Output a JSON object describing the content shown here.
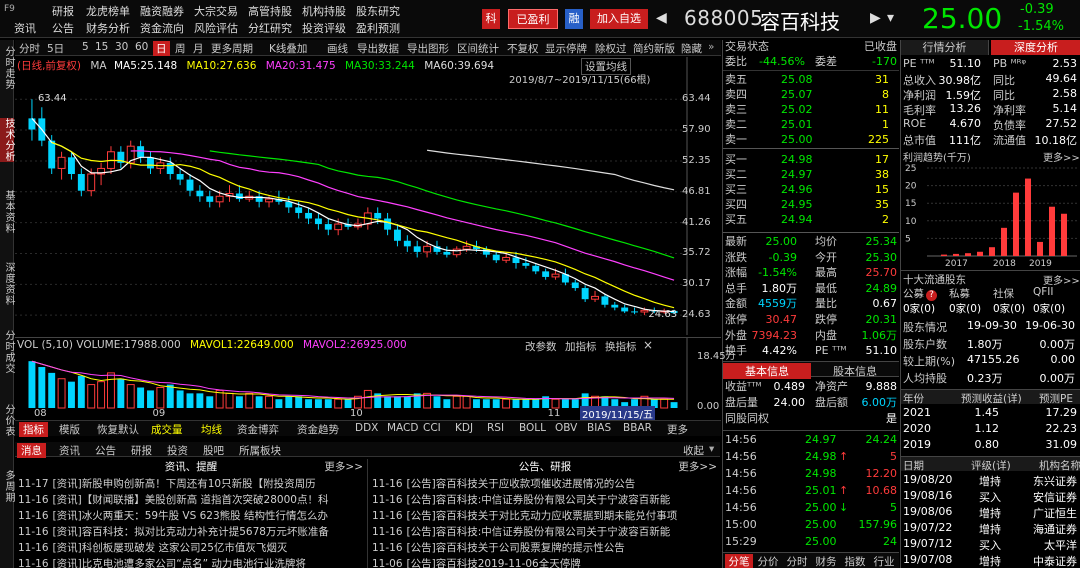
{
  "top": {
    "f9": "F9",
    "menu_row1": [
      "研报",
      "龙虎榜单",
      "融资融券",
      "大宗交易",
      "高管持股",
      "机构持股",
      "股东研究"
    ],
    "menu_row2": [
      "资讯",
      "公告",
      "财务分析",
      "资金流向",
      "风险评估",
      "分红研究",
      "投资评级",
      "盈利预测"
    ],
    "btn_rong": "融",
    "btn_yingli": "已盈利",
    "btn_ke": "科",
    "btn_add": "加入自选",
    "stock_code": "688005",
    "stock_name": "容百科技",
    "price": "25.00",
    "change": "-0.39",
    "change_pct": "-1.54%",
    "colors": {
      "up": "#ff3b3b",
      "down": "#00e600"
    }
  },
  "left_tabs": [
    "分时走势",
    "技术分析",
    "基本资料",
    "深度资料",
    "分时成交",
    "分价表",
    "多周期"
  ],
  "chart_toolbar": [
    "分时",
    "5日",
    "5",
    "15",
    "30",
    "60",
    "日",
    "周",
    "月",
    "更多周期",
    "K线叠加",
    "画线",
    "导出数据",
    "导出图形",
    "区间统计",
    "不复权",
    "显示停牌",
    "除权过",
    "简约新版",
    "隐藏"
  ],
  "chart_toolbar_active": "日",
  "ma_legend": {
    "prefix": "(日线,前复权)",
    "ma": "MA",
    "ma5": "MA5:25.148",
    "ma10": "MA10:27.636",
    "ma20": "MA20:31.475",
    "ma30": "MA30:33.244",
    "ma60": "MA60:39.694"
  },
  "chart_range": "2019/8/7~2019/11/15(66根)",
  "chart_settings": "设置均线",
  "chart_data": {
    "type": "candlestick",
    "y_ticks": [
      "63.44",
      "57.90",
      "52.35",
      "46.81",
      "41.26",
      "35.72",
      "30.17",
      "24.63"
    ],
    "ylim": [
      22.5,
      66
    ],
    "x_ticks": [
      "08",
      "09",
      "10",
      "11"
    ],
    "high_label": "63.44",
    "low_label": "24.63",
    "candles": [
      [
        58,
        63.44,
        56,
        60,
        "down"
      ],
      [
        60,
        62,
        55,
        56,
        "down"
      ],
      [
        56,
        57,
        50,
        51,
        "down"
      ],
      [
        51,
        54,
        49,
        53,
        "up"
      ],
      [
        53,
        54,
        49,
        50,
        "down"
      ],
      [
        50,
        51,
        46,
        47,
        "down"
      ],
      [
        47,
        51,
        46,
        50,
        "up"
      ],
      [
        50,
        52,
        48,
        51,
        "up"
      ],
      [
        51,
        55,
        50,
        54,
        "up"
      ],
      [
        54,
        55,
        51,
        52,
        "down"
      ],
      [
        52,
        56,
        51,
        55,
        "up"
      ],
      [
        55,
        56,
        52,
        53,
        "down"
      ],
      [
        53,
        54,
        50,
        51,
        "down"
      ],
      [
        51,
        53,
        50,
        52,
        "up"
      ],
      [
        52,
        53,
        49,
        50,
        "down"
      ],
      [
        50,
        51,
        48,
        49,
        "down"
      ],
      [
        49,
        50,
        46,
        47,
        "down"
      ],
      [
        47,
        48,
        45,
        46,
        "down"
      ],
      [
        46,
        47,
        44,
        45,
        "down"
      ],
      [
        45,
        47,
        44,
        46,
        "up"
      ],
      [
        46,
        48,
        45,
        46.5,
        "up"
      ],
      [
        46.5,
        48,
        45,
        45.5,
        "down"
      ],
      [
        45.5,
        47,
        45,
        46,
        "up"
      ],
      [
        46,
        47,
        44,
        45,
        "down"
      ],
      [
        45,
        46,
        44,
        45.5,
        "up"
      ],
      [
        45.5,
        47,
        44.5,
        45,
        "down"
      ],
      [
        45,
        46,
        43,
        44,
        "down"
      ],
      [
        44,
        45,
        42,
        43,
        "down"
      ],
      [
        43,
        44,
        41,
        42,
        "down"
      ],
      [
        42,
        43,
        40,
        41,
        "down"
      ],
      [
        41,
        42,
        39,
        40,
        "down"
      ],
      [
        40,
        42,
        39,
        41,
        "up"
      ],
      [
        41,
        42,
        40,
        40.5,
        "down"
      ],
      [
        40.5,
        42,
        40,
        41,
        "up"
      ],
      [
        41,
        44,
        40,
        43,
        "up"
      ],
      [
        43,
        44,
        41,
        42,
        "down"
      ],
      [
        42,
        43,
        39,
        40,
        "down"
      ],
      [
        40,
        41,
        37,
        38,
        "down"
      ],
      [
        38,
        39,
        36,
        37,
        "down"
      ],
      [
        37,
        38,
        35,
        36,
        "down"
      ],
      [
        36,
        38,
        35,
        37,
        "up"
      ],
      [
        37,
        38,
        35.5,
        36,
        "down"
      ],
      [
        36,
        37,
        35,
        35.5,
        "down"
      ],
      [
        35.5,
        37,
        35,
        36.5,
        "up"
      ],
      [
        36.5,
        38,
        36,
        37,
        "up"
      ],
      [
        37,
        38,
        36,
        36.5,
        "down"
      ],
      [
        36.5,
        37,
        35,
        35.5,
        "down"
      ],
      [
        35.5,
        36,
        34,
        34.5,
        "down"
      ],
      [
        34.5,
        36,
        34,
        35,
        "up"
      ],
      [
        35,
        36,
        33,
        34,
        "down"
      ],
      [
        34,
        35,
        33,
        33.5,
        "down"
      ],
      [
        33.5,
        34,
        32,
        32.5,
        "down"
      ],
      [
        32.5,
        33,
        31,
        31.5,
        "down"
      ],
      [
        31.5,
        33,
        31,
        32,
        "up"
      ],
      [
        32,
        33,
        30,
        30.5,
        "down"
      ],
      [
        30.5,
        31,
        29,
        29.5,
        "down"
      ],
      [
        29.5,
        30,
        27,
        27.5,
        "down"
      ],
      [
        27.5,
        29,
        27,
        28,
        "up"
      ],
      [
        28,
        28.5,
        26,
        26.5,
        "down"
      ],
      [
        26.5,
        27,
        25.5,
        26,
        "down"
      ],
      [
        26,
        26.5,
        25,
        25.3,
        "down"
      ],
      [
        25.3,
        26,
        24.8,
        25.2,
        "down"
      ],
      [
        25.2,
        26,
        24.63,
        25.5,
        "up"
      ],
      [
        25.5,
        26,
        25,
        25.3,
        "down"
      ],
      [
        25.3,
        25.8,
        24.9,
        25.39,
        "up"
      ],
      [
        25.39,
        25.6,
        24.8,
        25.0,
        "down"
      ]
    ],
    "vol_legend": {
      "vol": "VOL (5,10) VOLUME:17988.000",
      "mavol1": "MAVOL1:22649.000",
      "mavol2": "MAVOL2:26925.000"
    },
    "vol_ticks": [
      "18.45万",
      "0.00"
    ],
    "vol_ylim": [
      0,
      18.45
    ],
    "volume": [
      16,
      14,
      12,
      10,
      9,
      11,
      8,
      9,
      12,
      10,
      8,
      7,
      6,
      7,
      8,
      6,
      5,
      5,
      4,
      6,
      5,
      4,
      5,
      4,
      4,
      3,
      4,
      4,
      3,
      3,
      3,
      3,
      3,
      4,
      6,
      5,
      4,
      4,
      4,
      5,
      5,
      4,
      3,
      4,
      4,
      3,
      3,
      3,
      3,
      3,
      3,
      3,
      4,
      3,
      3,
      3,
      5,
      4,
      4,
      3,
      2,
      3,
      4,
      3,
      3,
      2
    ]
  },
  "vol_tools": [
    "改参数",
    "加指标",
    "换指标"
  ],
  "date_tag": "2019/11/15/五",
  "ind_tabs": [
    "指标",
    "模版",
    "恢复默认",
    "成交量",
    "均线",
    "资金博弈",
    "资金趋势",
    "DDX",
    "MACD",
    "CCI",
    "KDJ",
    "RSI",
    "BOLL",
    "OBV",
    "BIAS",
    "BBAR",
    "更多"
  ],
  "news_tabs": [
    "消息",
    "资讯",
    "公告",
    "研报",
    "投资",
    "股吧",
    "所属板块"
  ],
  "news_collapse": "收起",
  "news_left_head": "资讯、提醒",
  "news_right_head": "公告、研报",
  "news_more": "更多>>",
  "news_left": [
    {
      "date": "11-17",
      "text": "[资讯]新股申购创新高！下周还有10只新股【附投资周历"
    },
    {
      "date": "11-16",
      "text": "[资讯]【财闻联播】美股创新高 道指首次突破28000点！科"
    },
    {
      "date": "11-16",
      "text": "[资讯]冰火两重天：59牛股 VS 623熊股 结构性行情怎么办"
    },
    {
      "date": "11-16",
      "text": "[资讯]容百科技：拟对比克动力补充计提5678万元坏账准备"
    },
    {
      "date": "11-16",
      "text": "[资讯]科创板屡现破发 这家公司25亿市值灰飞烟灭"
    },
    {
      "date": "11-16",
      "text": "[资讯]比克电池遭多家公司“点名” 动力电池行业洗牌将"
    }
  ],
  "news_right": [
    {
      "date": "11-16",
      "text": "[公告]容百科技关于应收款项催收进展情况的公告"
    },
    {
      "date": "11-16",
      "text": "[公告]容百科技:中信证券股份有限公司关于宁波容百新能"
    },
    {
      "date": "11-16",
      "text": "[公告]容百科技关于对比克动力应收票据到期未能兑付事项"
    },
    {
      "date": "11-16",
      "text": "[公告]容百科技:中信证券股份有限公司关于宁波容百新能"
    },
    {
      "date": "11-16",
      "text": "[公告]容百科技关于公司股票复牌的提示性公告"
    },
    {
      "date": "11-06",
      "text": "[公告]容百科技2019-11-06全天停牌"
    }
  ],
  "orderbook": {
    "status_label": "交易状态",
    "status_value": "已收盘",
    "weibi_label": "委比",
    "weibi_value": "-44.56%",
    "weicha_label": "委差",
    "weicha_value": "-170",
    "sells": [
      {
        "label": "卖五",
        "price": "25.08",
        "vol": "31"
      },
      {
        "label": "卖四",
        "price": "25.07",
        "vol": "8"
      },
      {
        "label": "卖三",
        "price": "25.02",
        "vol": "11"
      },
      {
        "label": "卖二",
        "price": "25.01",
        "vol": "1"
      },
      {
        "label": "卖一",
        "price": "25.00",
        "vol": "225"
      }
    ],
    "buys": [
      {
        "label": "买一",
        "price": "24.98",
        "vol": "17"
      },
      {
        "label": "买二",
        "price": "24.97",
        "vol": "38"
      },
      {
        "label": "买三",
        "price": "24.96",
        "vol": "15"
      },
      {
        "label": "买四",
        "price": "24.95",
        "vol": "35"
      },
      {
        "label": "买五",
        "price": "24.94",
        "vol": "2"
      }
    ],
    "stats": [
      {
        "l1": "最新",
        "v1": "25.00",
        "c1": "green",
        "l2": "均价",
        "v2": "25.34",
        "c2": "green"
      },
      {
        "l1": "涨跌",
        "v1": "-0.39",
        "c1": "green",
        "l2": "今开",
        "v2": "25.30",
        "c2": "green"
      },
      {
        "l1": "涨幅",
        "v1": "-1.54%",
        "c1": "green",
        "l2": "最高",
        "v2": "25.70",
        "c2": "red"
      },
      {
        "l1": "总手",
        "v1": "1.80万",
        "c1": "white",
        "l2": "最低",
        "v2": "24.89",
        "c2": "green"
      },
      {
        "l1": "金额",
        "v1": "4559万",
        "c1": "cyan",
        "l2": "量比",
        "v2": "0.67",
        "c2": "white"
      },
      {
        "l1": "涨停",
        "v1": "30.47",
        "c1": "red",
        "l2": "跌停",
        "v2": "20.31",
        "c2": "green"
      },
      {
        "l1": "外盘",
        "v1": "7394.23",
        "c1": "red",
        "l2": "内盘",
        "v2": "1.06万",
        "c2": "green"
      },
      {
        "l1": "换手",
        "v1": "4.42%",
        "c1": "white",
        "l2": "PE ᵀᵀᴹ",
        "v2": "51.10",
        "c2": "white"
      }
    ],
    "info_tabs": [
      "基本信息",
      "股本信息"
    ],
    "info": [
      {
        "l1": "收益ᵀᵀᴹ",
        "v1": "0.489",
        "l2": "净资产",
        "v2": "9.888"
      },
      {
        "l1": "盘后量",
        "v1": "24.00",
        "l2": "盘后额",
        "v2": "6.00万"
      },
      {
        "l1": "同股同权",
        "v1": "",
        "l2": "",
        "v2": "是"
      }
    ],
    "ticks": [
      {
        "t": "14:56",
        "p": "24.97",
        "v": "24.24",
        "arrow": "",
        "pc": "green",
        "vc": "green"
      },
      {
        "t": "14:56",
        "p": "24.98",
        "v": "5",
        "arrow": "↑",
        "pc": "green",
        "vc": "red"
      },
      {
        "t": "14:56",
        "p": "24.98",
        "v": "12.20",
        "arrow": "",
        "pc": "green",
        "vc": "red"
      },
      {
        "t": "14:56",
        "p": "25.01",
        "v": "10.68",
        "arrow": "↑",
        "pc": "green",
        "vc": "red"
      },
      {
        "t": "14:56",
        "p": "25.00",
        "v": "5",
        "arrow": "↓",
        "pc": "green",
        "vc": "green"
      },
      {
        "t": "15:00",
        "p": "25.00",
        "v": "157.96",
        "arrow": "",
        "pc": "green",
        "vc": "green"
      },
      {
        "t": "15:29",
        "p": "25.00",
        "v": "24",
        "arrow": "",
        "pc": "green",
        "vc": "green"
      }
    ],
    "bottom_tabs": [
      "分笔",
      "分价",
      "分时",
      "财务",
      "指数",
      "行业"
    ]
  },
  "deep": {
    "tabs": [
      "行情分析",
      "深度分析"
    ],
    "rows": [
      {
        "l1": "PE ᵀᵀᴹ",
        "v1": "51.10",
        "l2": "PB ᴹᴿᵠ",
        "v2": "2.53"
      },
      {
        "l1": "总收入",
        "v1": "30.98亿",
        "l2": "同比",
        "v2": "49.64"
      },
      {
        "l1": "净利润",
        "v1": "1.59亿",
        "l2": "同比",
        "v2": "2.58"
      },
      {
        "l1": "毛利率",
        "v1": "13.26",
        "l2": "净利率",
        "v2": "5.14"
      },
      {
        "l1": "ROE",
        "v1": "4.670",
        "l2": "负债率",
        "v2": "27.52"
      },
      {
        "l1": "总市值",
        "v1": "111亿",
        "l2": "流通值",
        "v2": "10.18亿"
      }
    ],
    "profit_title": "利润趋势(千万)",
    "profit_more": "更多>>",
    "profit_yaxis": [
      "25",
      "20",
      "15",
      "10",
      "5"
    ],
    "profit_xaxis": [
      "2017",
      "2018",
      "2019"
    ],
    "profit_bars": [
      0.4,
      0.6,
      0.8,
      1.2,
      2.5,
      8,
      18,
      22,
      4,
      14,
      12
    ],
    "holders_title": "十大流通股东",
    "holders_more": "更多>>",
    "holders_cols": [
      "公募",
      "私募",
      "社保",
      "QFII"
    ],
    "holders_vals": [
      "0家(0)",
      "0家(0)",
      "0家(0)",
      "0家(0)"
    ],
    "holders_rows": [
      {
        "l": "股东情况",
        "v1": "19-09-30",
        "v2": "19-06-30"
      },
      {
        "l": "股东户数",
        "v1": "1.80万",
        "v2": "0.00万"
      },
      {
        "l": "较上期(%)",
        "v1": "47155.26",
        "v2": "0.00"
      },
      {
        "l": "人均持股",
        "v1": "0.23万",
        "v2": "0.00万"
      }
    ],
    "forecast_head": [
      "年份",
      "预测收益(详)",
      "预测PE"
    ],
    "forecast": [
      {
        "y": "2021",
        "e": "1.45",
        "pe": "17.29"
      },
      {
        "y": "2020",
        "e": "1.12",
        "pe": "22.23"
      },
      {
        "y": "2019",
        "e": "0.80",
        "pe": "31.09"
      }
    ],
    "rating_head": [
      "日期",
      "评级(详)",
      "机构名称"
    ],
    "ratings": [
      {
        "d": "19/08/20",
        "r": "增持",
        "org": "东兴证券"
      },
      {
        "d": "19/08/16",
        "r": "买入",
        "org": "安信证券"
      },
      {
        "d": "19/08/06",
        "r": "增持",
        "org": "广证恒生"
      },
      {
        "d": "19/07/22",
        "r": "增持",
        "org": "海通证券"
      },
      {
        "d": "19/07/12",
        "r": "买入",
        "org": "太平洋"
      },
      {
        "d": "19/07/08",
        "r": "增持",
        "org": "中泰证券"
      }
    ]
  }
}
